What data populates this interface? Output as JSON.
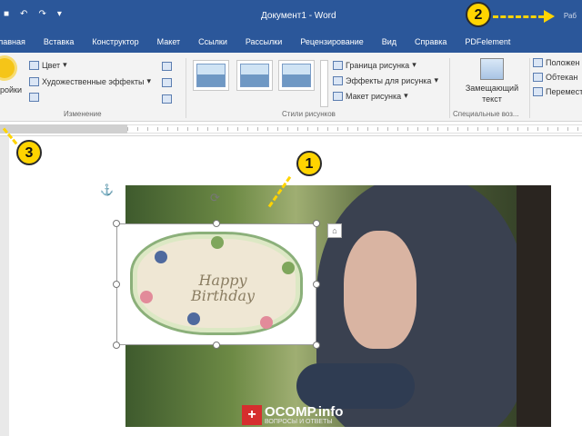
{
  "titlebar": {
    "qat_icons": [
      "save-icon",
      "undo-icon",
      "redo-icon",
      "qat-menu-icon"
    ],
    "qat_glyphs": [
      "■",
      "↶",
      "↷",
      "▾"
    ],
    "doc_title": "Документ1 - Word",
    "right_tag": "Раб"
  },
  "tabs": [
    "лавная",
    "Вставка",
    "Конструктор",
    "Макет",
    "Ссылки",
    "Рассылки",
    "Рецензирование",
    "Вид",
    "Справка",
    "PDFelement"
  ],
  "ribbon": {
    "corrections_label": "ройки",
    "color_label": "Цвет",
    "art_effects_label": "Художественные эффекты",
    "adjust_group_label": "Изменение",
    "border_label": "Граница рисунка",
    "effects_label": "Эффекты для рисунка",
    "layout_label": "Макет рисунка",
    "styles_group_label": "Стили рисунков",
    "alt_text_line1": "Замещающий",
    "alt_text_line2": "текст",
    "accessibility_group_label": "Специальные воз...",
    "position_label": "Положен",
    "wrap_label": "Обтекан",
    "bring_forward_label": "Перемест",
    "dropdown_arrow": "▾"
  },
  "document": {
    "card_text_line1": "Happy",
    "card_text_line2": "Birthday",
    "anchor_glyph": "⚓",
    "rotate_glyph": "⟳",
    "layout_options_glyph": "⌂"
  },
  "watermark": {
    "plus": "+",
    "name": "OCOMP.info",
    "tagline": "ВОПРОСЫ И ОТВЕТЫ"
  },
  "callouts": [
    "1",
    "2",
    "3"
  ],
  "colors": {
    "word_blue": "#2b579a",
    "ribbon_bg": "#f3f3f3",
    "callout_yellow": "#ffd400"
  }
}
